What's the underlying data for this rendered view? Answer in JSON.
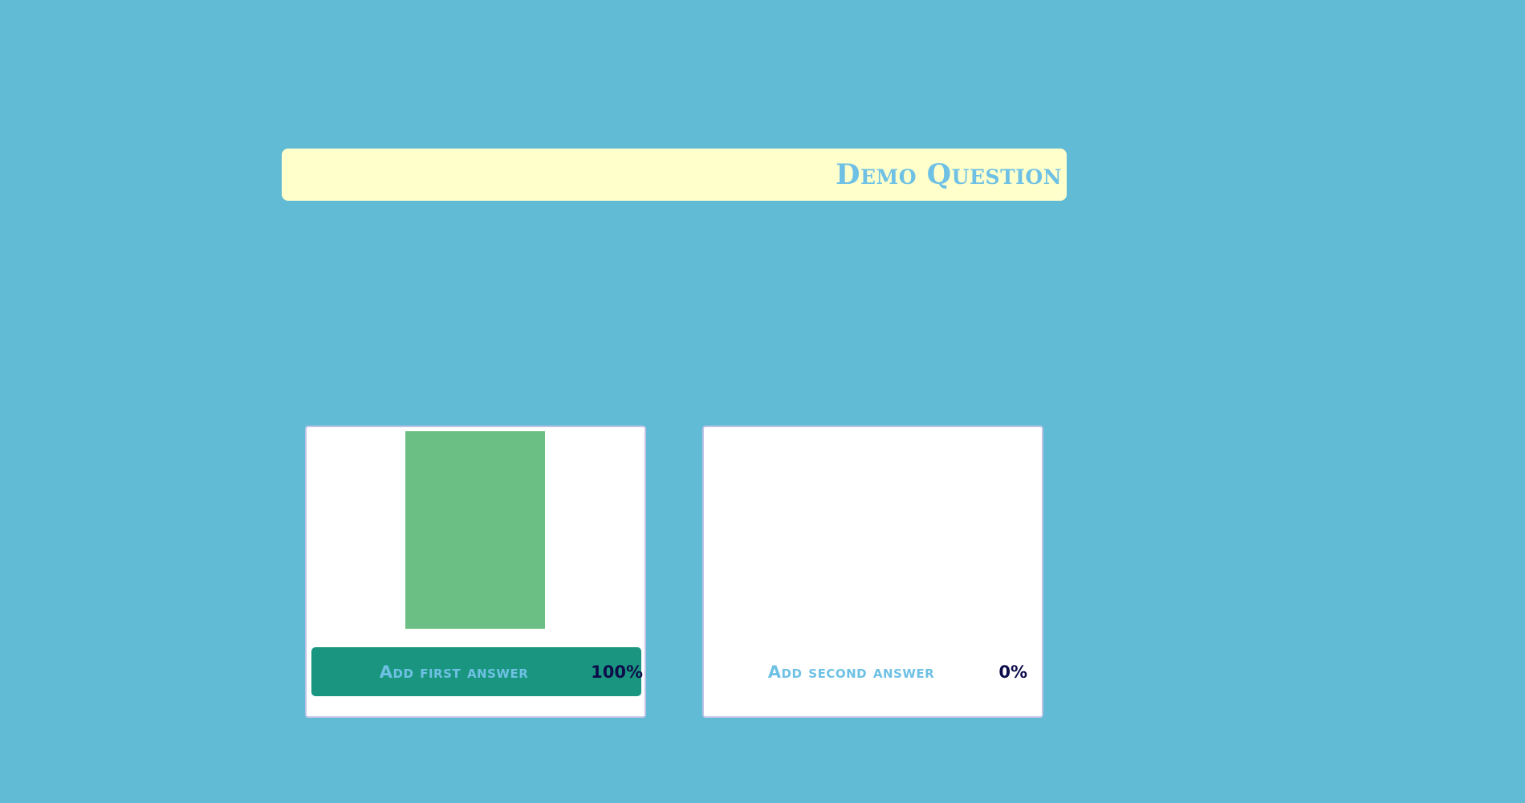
{
  "question": {
    "title": "Demo Question"
  },
  "answers": [
    {
      "label": "Add first answer",
      "percent_text": "100%",
      "share": 1.0,
      "selected": true
    },
    {
      "label": "Add second answer",
      "percent_text": "0%",
      "share": 0.0,
      "selected": false
    }
  ],
  "colors": {
    "background": "#61bbd4",
    "question_bar": "#ffffcc",
    "accent_text": "#6ec1e4",
    "result_bar": "#6cbf84",
    "selected_button": "#1a9680",
    "percent_text": "#0d0d4a"
  }
}
